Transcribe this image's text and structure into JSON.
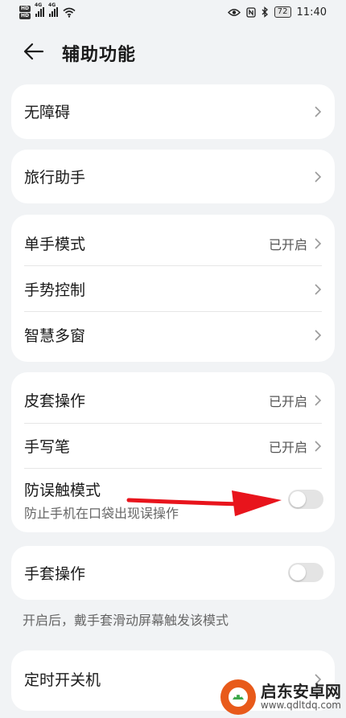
{
  "status_bar": {
    "hd1": "HD",
    "hd2": "HD",
    "signal1_tag": "4G",
    "signal2_tag": "4G",
    "battery": "72",
    "time": "11:40",
    "icons": [
      "eye-icon",
      "nfc-icon",
      "bluetooth-icon",
      "wifi-icon"
    ]
  },
  "header": {
    "title": "辅助功能",
    "back_icon": "arrow-left-icon"
  },
  "cards": {
    "accessibility": {
      "label": "无障碍"
    },
    "travel": {
      "label": "旅行助手"
    },
    "group1": {
      "one_hand": {
        "label": "单手模式",
        "value": "已开启"
      },
      "gesture": {
        "label": "手势控制"
      },
      "multi_window": {
        "label": "智慧多窗"
      }
    },
    "group2": {
      "cover": {
        "label": "皮套操作",
        "value": "已开启"
      },
      "stylus": {
        "label": "手写笔",
        "value": "已开启"
      },
      "pocket_mode": {
        "label": "防误触模式",
        "sub": "防止手机在口袋出现误操作",
        "enabled": false
      }
    },
    "glove": {
      "label": "手套操作",
      "enabled": false
    },
    "glove_hint": "开启后，戴手套滑动屏幕触发该模式",
    "schedule": {
      "label": "定时开关机"
    }
  },
  "annotation": {
    "arrow_color": "#e8141c"
  },
  "watermark": {
    "name": "启东安卓网",
    "url": "www.qdltdq.com"
  },
  "colors": {
    "background": "#f1f3f5",
    "card": "#ffffff",
    "toggle_off": "#e4e4e4"
  }
}
